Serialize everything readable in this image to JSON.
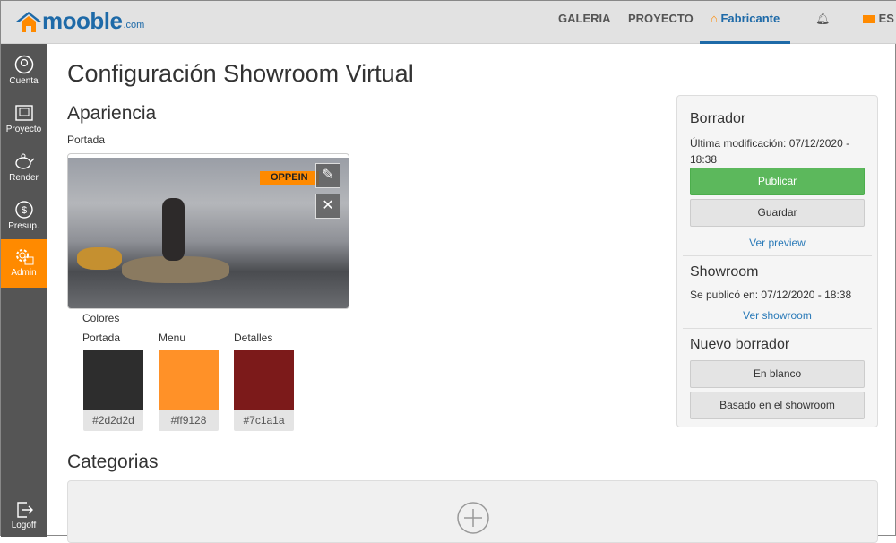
{
  "header": {
    "logo_text": "mooble",
    "logo_suffix": ".com",
    "nav": [
      "GALERIA",
      "PROYECTO",
      "Fabricante"
    ],
    "lang": "ES"
  },
  "sidebar": {
    "items": [
      "Cuenta",
      "Proyecto",
      "Render",
      "Presup.",
      "Admin"
    ],
    "logoff": "Logoff"
  },
  "page": {
    "title": "Configuración Showroom Virtual",
    "apariencia": "Apariencia",
    "portada": "Portada",
    "cover_logo": "OPPEIN",
    "colores": "Colores",
    "colors": [
      {
        "label": "Portada",
        "hex": "#2d2d2d",
        "color": "#2d2d2d"
      },
      {
        "label": "Menu",
        "hex": "#ff9128",
        "color": "#ff9128"
      },
      {
        "label": "Detalles",
        "hex": "#7c1a1a",
        "color": "#7c1a1a"
      }
    ],
    "categorias": "Categorias"
  },
  "panel": {
    "borrador": "Borrador",
    "last_mod": "Última modificación: 07/12/2020 - 18:38",
    "publicar": "Publicar",
    "guardar": "Guardar",
    "ver_preview": "Ver preview",
    "showroom": "Showroom",
    "published": "Se publicó en: 07/12/2020 - 18:38",
    "ver_showroom": "Ver showroom",
    "nuevo": "Nuevo borrador",
    "en_blanco": "En blanco",
    "basado": "Basado en el showroom"
  }
}
